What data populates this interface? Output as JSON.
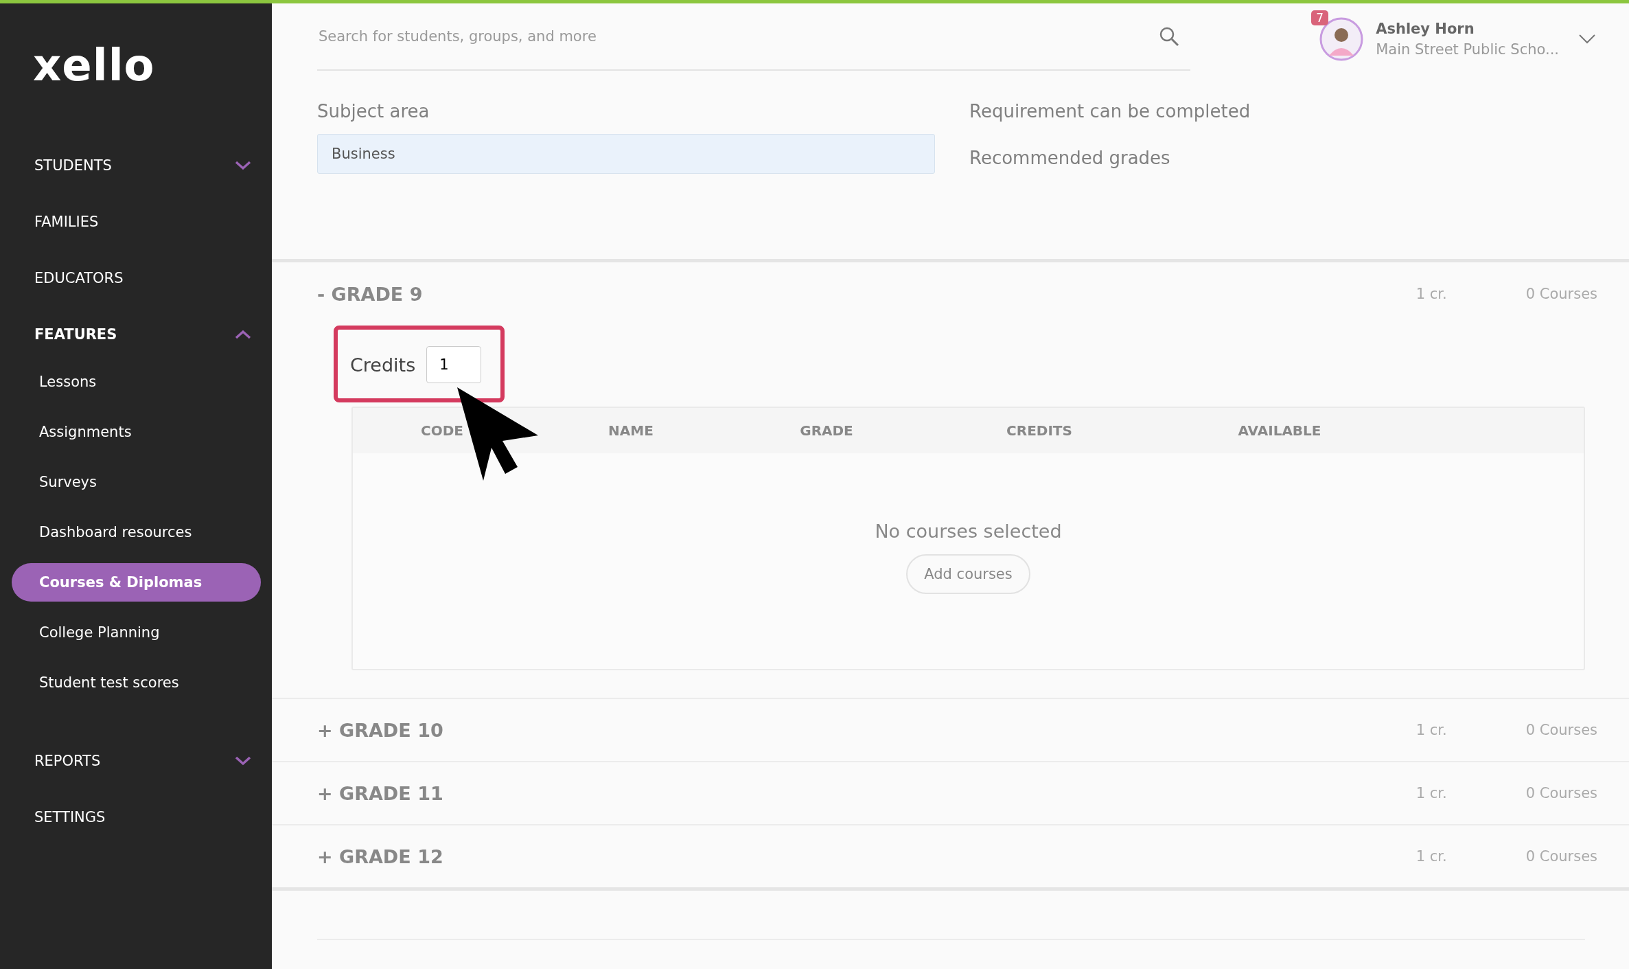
{
  "sidebar": {
    "logo": "xello",
    "items": [
      {
        "kind": "section",
        "label": "STUDENTS",
        "expanded": false,
        "selected": false
      },
      {
        "kind": "section",
        "label": "FAMILIES",
        "selected": false
      },
      {
        "kind": "section",
        "label": "EDUCATORS",
        "selected": false
      },
      {
        "kind": "section",
        "label": "FEATURES",
        "expanded": true,
        "selected": true
      },
      {
        "kind": "sub",
        "label": "Lessons",
        "selected": false
      },
      {
        "kind": "sub",
        "label": "Assignments",
        "selected": false
      },
      {
        "kind": "sub",
        "label": "Surveys",
        "selected": false
      },
      {
        "kind": "sub",
        "label": "Dashboard resources",
        "selected": false
      },
      {
        "kind": "sub",
        "label": "Courses & Diplomas",
        "selected": true
      },
      {
        "kind": "sub",
        "label": "College Planning",
        "selected": false
      },
      {
        "kind": "sub",
        "label": "Student test scores",
        "selected": false
      },
      {
        "kind": "section",
        "label": "REPORTS",
        "expanded": false,
        "selected": false
      },
      {
        "kind": "section",
        "label": "SETTINGS",
        "selected": false
      }
    ]
  },
  "header": {
    "search": {
      "placeholder": "Search for students, groups, and more"
    },
    "user": {
      "name": "Ashley Horn",
      "school": "Main Street Public Scho...",
      "notifications": "7"
    }
  },
  "form": {
    "subject_area": {
      "label": "Subject area",
      "value": "Business"
    },
    "requirement": "Requirement can be completed",
    "recommended": "Recommended grades"
  },
  "grades": [
    {
      "title": "- GRADE 9",
      "expanded": true,
      "credits_summary": "1 cr.",
      "courses_summary": "0 Courses",
      "credits": {
        "label": "Credits",
        "value": "1",
        "highlighted": true,
        "pointer": true
      },
      "table": {
        "columns": [
          "CODE",
          "NAME",
          "GRADE",
          "CREDITS",
          "AVAILABLE"
        ],
        "empty": "No courses selected",
        "add_button": "Add courses"
      }
    },
    {
      "title": "+ GRADE 10",
      "expanded": false,
      "credits_summary": "1 cr.",
      "courses_summary": "0 Courses"
    },
    {
      "title": "+ GRADE 11",
      "expanded": false,
      "credits_summary": "1 cr.",
      "courses_summary": "0 Courses"
    },
    {
      "title": "+ GRADE 12",
      "expanded": false,
      "credits_summary": "1 cr.",
      "courses_summary": "0 Courses"
    }
  ]
}
